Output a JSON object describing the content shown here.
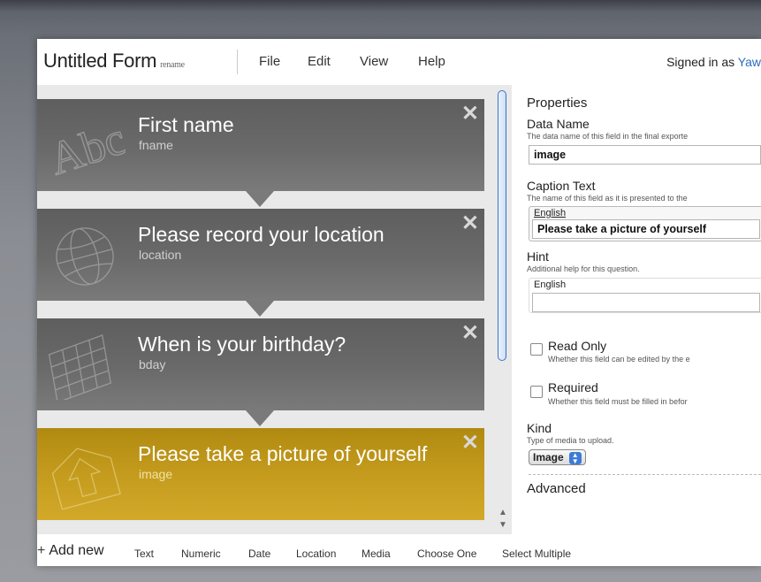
{
  "header": {
    "title": "Untitled Form",
    "rename": "rename",
    "menu": [
      "File",
      "Edit",
      "View",
      "Help"
    ],
    "signed_in_prefix": "Signed in as",
    "signed_in_user": "Yaw"
  },
  "fields": [
    {
      "title": "First name",
      "name": "fname",
      "icon": "abc-text-icon",
      "selected": false
    },
    {
      "title": "Please record your location",
      "name": "location",
      "icon": "globe-icon",
      "selected": false
    },
    {
      "title": "When is your birthday?",
      "name": "bday",
      "icon": "calendar-icon",
      "selected": false
    },
    {
      "title": "Please take a picture of yourself",
      "name": "image",
      "icon": "upload-arrow-icon",
      "selected": true
    }
  ],
  "close_glyph": "✕",
  "toolbar": {
    "add_new": "Add new",
    "plus": "+",
    "types": [
      "Text",
      "Numeric",
      "Date",
      "Location",
      "Media",
      "Choose One",
      "Select Multiple"
    ]
  },
  "properties": {
    "heading": "Properties",
    "data_name_label": "Data Name",
    "data_name_help": "The data name of this field in the final exporte",
    "data_name_value": "image",
    "caption_label": "Caption Text",
    "caption_help": "The name of this field as it is presented to the",
    "caption_lang": "English",
    "caption_value": "Please take a picture of yourself",
    "hint_label": "Hint",
    "hint_help": "Additional help for this question.",
    "hint_lang": "English",
    "hint_value": "",
    "read_only_label": "Read Only",
    "read_only_help": "Whether this field can be edited by the e",
    "required_label": "Required",
    "required_help": "Whether this field must be filled in befor",
    "kind_label": "Kind",
    "kind_help": "Type of media to upload.",
    "kind_value": "Image",
    "advanced_label": "Advanced"
  },
  "colors": {
    "card_gray": "#6a6a6a",
    "card_selected": "#c49b1d",
    "link_blue": "#2a6ebb"
  }
}
